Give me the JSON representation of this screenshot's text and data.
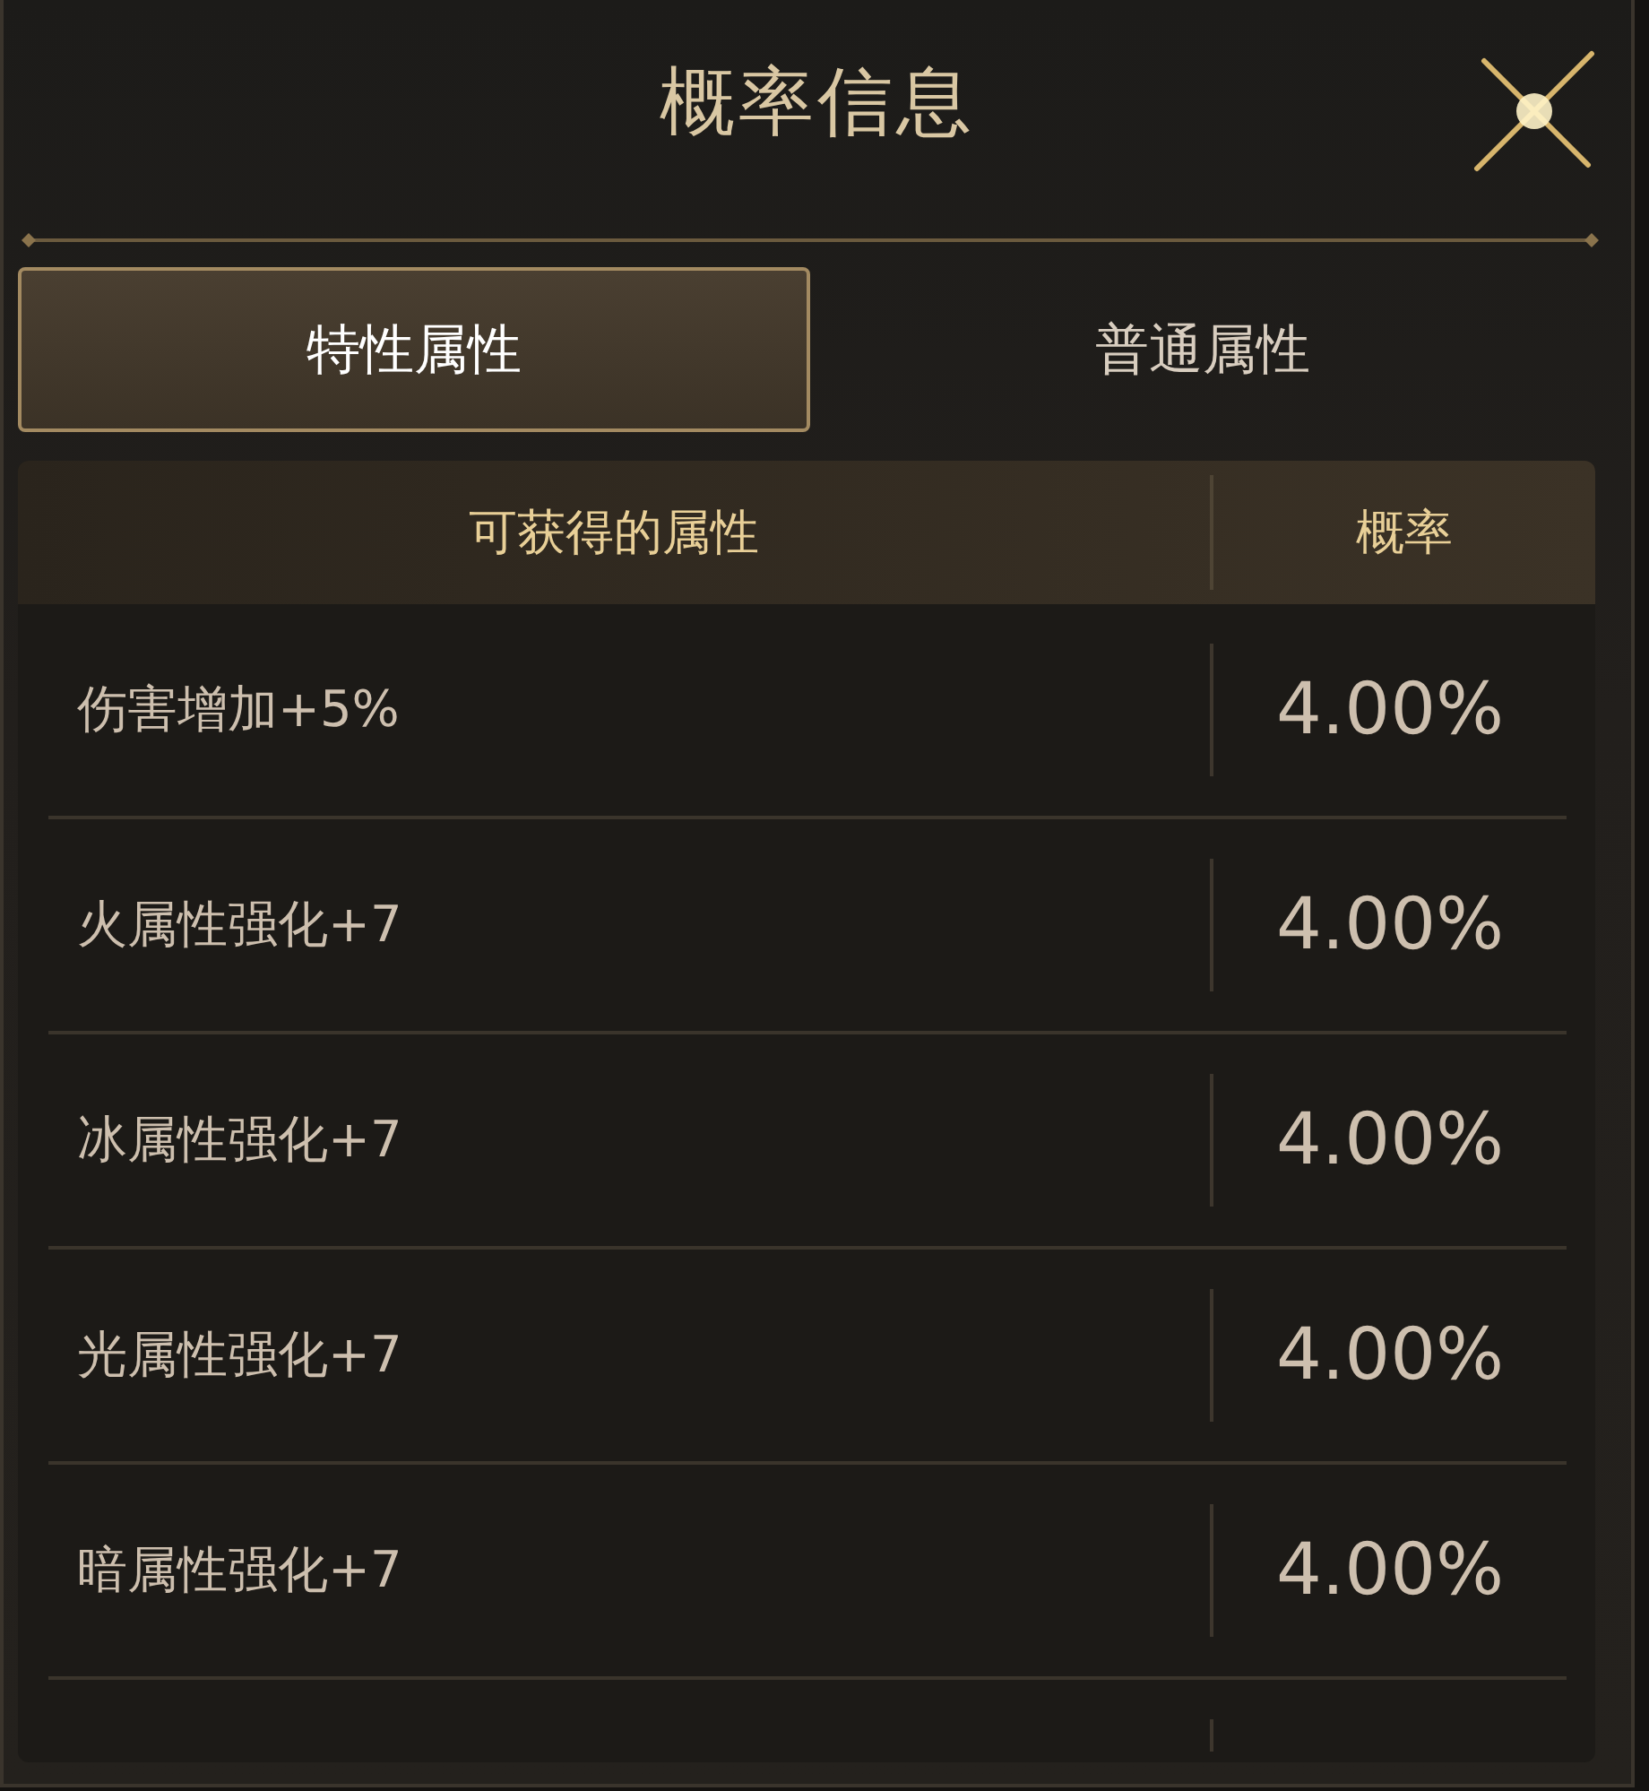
{
  "window": {
    "title": "概率信息"
  },
  "tabs": [
    {
      "label": "特性属性",
      "selected": true
    },
    {
      "label": "普通属性",
      "selected": false
    }
  ],
  "table": {
    "columns": [
      "可获得的属性",
      "概率"
    ],
    "rows": [
      {
        "attribute": "伤害增加+5%",
        "probability": "4.00%"
      },
      {
        "attribute": "火属性强化+7",
        "probability": "4.00%"
      },
      {
        "attribute": "冰属性强化+7",
        "probability": "4.00%"
      },
      {
        "attribute": "光属性强化+7",
        "probability": "4.00%"
      },
      {
        "attribute": "暗属性强化+7",
        "probability": "4.00%"
      }
    ]
  }
}
